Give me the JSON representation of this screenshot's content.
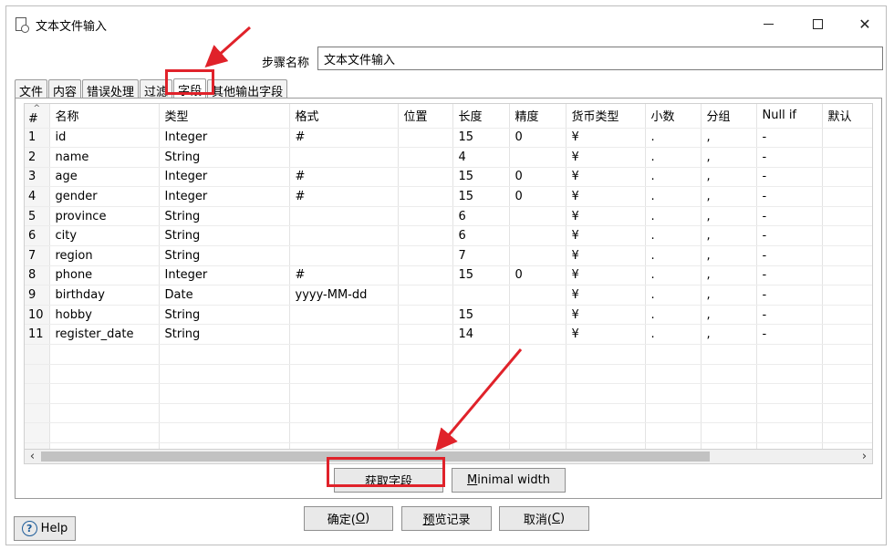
{
  "window": {
    "title": "文本文件输入"
  },
  "step": {
    "label": "步骤名称",
    "value": "文本文件输入"
  },
  "tabs": [
    {
      "label": "文件"
    },
    {
      "label": "内容"
    },
    {
      "label": "错误处理"
    },
    {
      "label": "过滤"
    },
    {
      "label": "字段",
      "active": true
    },
    {
      "label": "其他输出字段"
    }
  ],
  "grid": {
    "headers": [
      "#",
      "名称",
      "类型",
      "格式",
      "位置",
      "长度",
      "精度",
      "货币类型",
      "小数",
      "分组",
      "Null if",
      "默认"
    ],
    "rows": [
      [
        "1",
        "id",
        "Integer",
        "#",
        "",
        "15",
        "0",
        "¥",
        ".",
        ",",
        "-",
        ""
      ],
      [
        "2",
        "name",
        "String",
        "",
        "",
        "4",
        "",
        "¥",
        ".",
        ",",
        "-",
        ""
      ],
      [
        "3",
        "age",
        "Integer",
        "#",
        "",
        "15",
        "0",
        "¥",
        ".",
        ",",
        "-",
        ""
      ],
      [
        "4",
        "gender",
        "Integer",
        "#",
        "",
        "15",
        "0",
        "¥",
        ".",
        ",",
        "-",
        ""
      ],
      [
        "5",
        "province",
        "String",
        "",
        "",
        "6",
        "",
        "¥",
        ".",
        ",",
        "-",
        ""
      ],
      [
        "6",
        "city",
        "String",
        "",
        "",
        "6",
        "",
        "¥",
        ".",
        ",",
        "-",
        ""
      ],
      [
        "7",
        "region",
        "String",
        "",
        "",
        "7",
        "",
        "¥",
        ".",
        ",",
        "-",
        ""
      ],
      [
        "8",
        "phone",
        "Integer",
        "#",
        "",
        "15",
        "0",
        "¥",
        ".",
        ",",
        "-",
        ""
      ],
      [
        "9",
        "birthday",
        "Date",
        "yyyy-MM-dd",
        "",
        "",
        "",
        "¥",
        ".",
        ",",
        "-",
        ""
      ],
      [
        "10",
        "hobby",
        "String",
        "",
        "",
        "15",
        "",
        "¥",
        ".",
        ",",
        "-",
        ""
      ],
      [
        "11",
        "register_date",
        "String",
        "",
        "",
        "14",
        "",
        "¥",
        ".",
        ",",
        "-",
        ""
      ]
    ],
    "empty_rows": 6
  },
  "buttons": {
    "get_fields": {
      "before": "",
      "mnemonic": "获",
      "after": "取字段"
    },
    "minimal_width": {
      "before": "",
      "mnemonic": "M",
      "after": "inimal width"
    },
    "ok": {
      "before": "确定(",
      "mnemonic": "O",
      "after": ")"
    },
    "preview": {
      "before": "",
      "mnemonic": "预",
      "after": "览记录"
    },
    "cancel": {
      "before": "取消(",
      "mnemonic": "C",
      "after": ")"
    },
    "help": "Help"
  },
  "icons": {
    "app": "text-file-input-icon",
    "minimize": "minimize-icon",
    "maximize": "maximize-icon",
    "close": "close-icon",
    "help": "help-icon",
    "scroll_left": "scroll-left-arrow-icon",
    "scroll_right": "scroll-right-arrow-icon"
  },
  "colors": {
    "annotation": "#e0222a",
    "help_icon": "#1d5c99"
  }
}
